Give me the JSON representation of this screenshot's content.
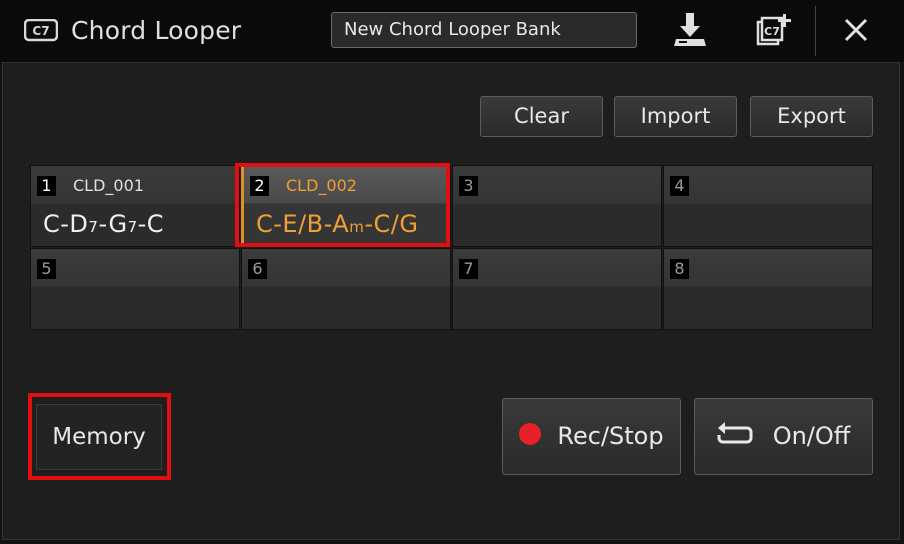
{
  "header": {
    "title": "Chord Looper",
    "app_icon": "c7-chord-icon",
    "bank_name": "New Chord Looper Bank",
    "save_icon": "save-download-icon",
    "new_bank_icon": "new-chord-bank-icon",
    "close_icon": "close-icon"
  },
  "toolbar": {
    "clear_label": "Clear",
    "import_label": "Import",
    "export_label": "Export"
  },
  "cells": [
    {
      "number": "1",
      "name": "CLD_001",
      "chords": "C-D7-G7-C",
      "selected": false
    },
    {
      "number": "2",
      "name": "CLD_002",
      "chords": "C-E/B-Am-C/G",
      "selected": true
    },
    {
      "number": "3",
      "name": "",
      "chords": "",
      "selected": false
    },
    {
      "number": "4",
      "name": "",
      "chords": "",
      "selected": false
    },
    {
      "number": "5",
      "name": "",
      "chords": "",
      "selected": false
    },
    {
      "number": "6",
      "name": "",
      "chords": "",
      "selected": false
    },
    {
      "number": "7",
      "name": "",
      "chords": "",
      "selected": false
    },
    {
      "number": "8",
      "name": "",
      "chords": "",
      "selected": false
    }
  ],
  "controls": {
    "memory_label": "Memory",
    "rec_stop_label": "Rec/Stop",
    "on_off_label": "On/Off"
  },
  "colors": {
    "accent": "#f0a030",
    "highlight": "#e01010",
    "record": "#e8202a"
  }
}
